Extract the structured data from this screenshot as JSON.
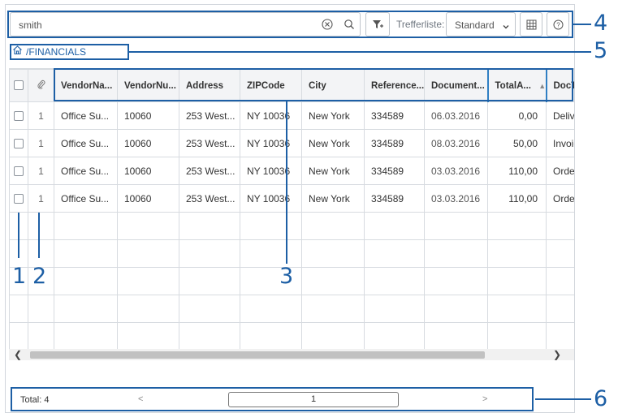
{
  "search": {
    "value": "smith"
  },
  "toolbar": {
    "trefferliste_label": "Trefferliste:",
    "result_view_value": "Standard"
  },
  "breadcrumb": {
    "path": "/FINANCIALS"
  },
  "table": {
    "columns": [
      "VendorNa...",
      "VendorNu...",
      "Address",
      "ZIPCode",
      "City",
      "Reference...",
      "Document...",
      "TotalA...",
      "DocTy"
    ],
    "rows": [
      [
        "1",
        "Office Su...",
        "10060",
        "253 West...",
        "NY 10036",
        "New York",
        "334589",
        "06.03.2016",
        "0,00",
        "Delive"
      ],
      [
        "1",
        "Office Su...",
        "10060",
        "253 West...",
        "NY 10036",
        "New York",
        "334589",
        "08.03.2016",
        "50,00",
        "Invoice"
      ],
      [
        "1",
        "Office Su...",
        "10060",
        "253 West...",
        "NY 10036",
        "New York",
        "334589",
        "03.03.2016",
        "110,00",
        "OrderC"
      ],
      [
        "1",
        "Office Su...",
        "10060",
        "253 West...",
        "NY 10036",
        "New York",
        "334589",
        "03.03.2016",
        "110,00",
        "OrderC"
      ]
    ]
  },
  "pager": {
    "total": "Total: 4",
    "prev": "<",
    "page": "1",
    "next": ">"
  },
  "callouts": [
    "1",
    "2",
    "3",
    "4",
    "5",
    "6"
  ],
  "colors": {
    "accent": "#1d5fa5",
    "grid_line": "#d7dbe0",
    "header_bg": "#f3f4f6"
  }
}
